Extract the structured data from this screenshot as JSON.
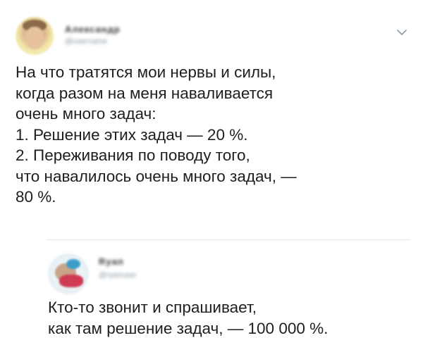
{
  "main_tweet": {
    "author_name": "Александр",
    "author_handle": "@username",
    "text_lines": [
      "На что тратятся мои нервы и силы,",
      "когда разом на меня наваливается",
      "очень много задач:",
      "1. Решение этих задач — 20 %.",
      "2. Переживания по поводу того,",
      "что навалилось очень много задач, —",
      "80 %."
    ],
    "menu_icon": "chevron-down-icon"
  },
  "reply": {
    "author_name": "Ryan",
    "author_handle": "@ryanuser",
    "text_lines": [
      "Кто-то звонит и спрашивает,",
      "как там решение задач, — 100 000 %."
    ]
  },
  "colors": {
    "text": "#1c1e21",
    "secondary": "#8899a6",
    "divider": "#e1e8ed"
  }
}
